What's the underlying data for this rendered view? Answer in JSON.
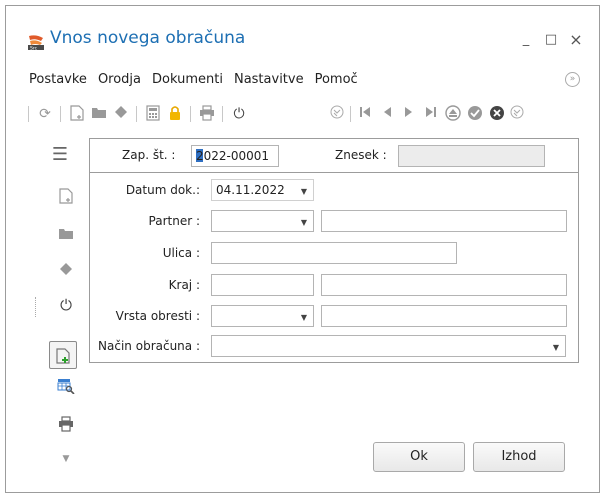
{
  "window": {
    "title": "Vnos novega obračuna",
    "minimize_label": "_",
    "maximize_label": "□",
    "close_label": "×"
  },
  "menu": {
    "items": [
      "Postavke",
      "Orodja",
      "Dokumenti",
      "Nastavitve",
      "Pomoč"
    ]
  },
  "header": {
    "zap_label": "Zap. št. :",
    "zap_value": "2022-00001",
    "znesek_label": "Znesek :",
    "znesek_value": ""
  },
  "form": {
    "datum_label": "Datum dok.:",
    "datum_value": "04.11.2022",
    "partner_label": "Partner :",
    "ulica_label": "Ulica :",
    "kraj_label": "Kraj :",
    "vrsta_label": "Vrsta obresti :",
    "nacin_label": "Način obračuna :"
  },
  "buttons": {
    "ok_label": "Ok",
    "izhod_label": "Izhod"
  },
  "colors": {
    "title": "#1d6fb3",
    "caret": "#2f6fc2",
    "border": "#9c9c9c"
  }
}
